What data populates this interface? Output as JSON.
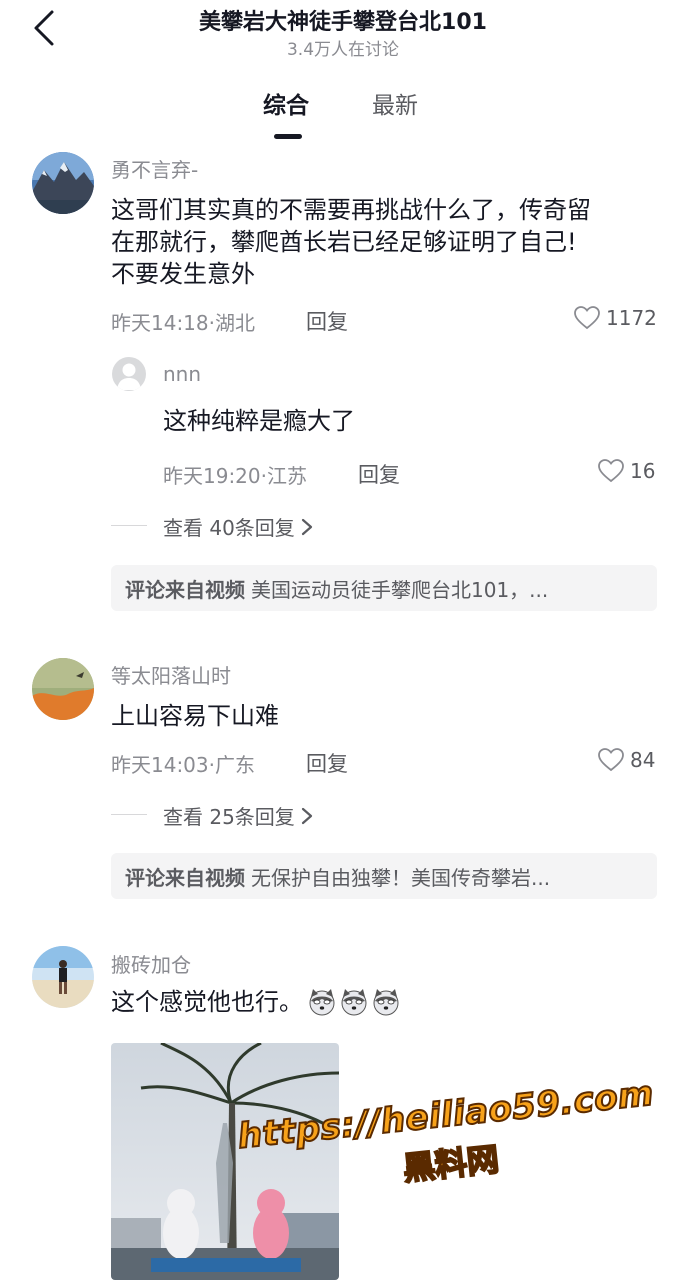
{
  "header": {
    "title": "美攀岩大神徒手攀登台北101",
    "subtitle": "3.4万人在讨论",
    "back_icon": "chevron-left-icon"
  },
  "tabs": [
    {
      "label": "综合",
      "active": true
    },
    {
      "label": "最新",
      "active": false
    }
  ],
  "comments": [
    {
      "username": "勇不言弃-",
      "content_lines": [
        "这哥们其实真的不需要再挑战什么了，传奇留",
        "在那就行，攀爬酋长岩已经足够证明了自己!",
        "不要发生意外"
      ],
      "time_location": "昨天14:18·湖北",
      "reply_label": "回复",
      "likes": "1172",
      "sub_reply": {
        "username": "nnn",
        "content": "这种纯粹是瘾大了",
        "time_location": "昨天19:20·江苏",
        "reply_label": "回复",
        "likes": "16"
      },
      "more_replies": "查看 40条回复",
      "source_label": "评论来自视频",
      "source_text": "美国运动员徒手攀爬台北101，..."
    },
    {
      "username": "等太阳落山时",
      "content_lines": [
        "上山容易下山难"
      ],
      "time_location": "昨天14:03·广东",
      "reply_label": "回复",
      "likes": "84",
      "more_replies": "查看 25条回复",
      "source_label": "评论来自视频",
      "source_text": "无保护自由独攀！美国传奇攀岩..."
    },
    {
      "username": "搬砖加仓",
      "content": "这个感觉他也行。",
      "emoji": [
        "husky-emoji",
        "husky-emoji",
        "husky-emoji"
      ]
    }
  ],
  "watermark": {
    "url": "https://heiliao59.com",
    "name": "黑料网"
  },
  "colors": {
    "primary_text": "#161823",
    "secondary_text": "#8a8b91",
    "source_bg": "#f4f4f5",
    "watermark": "#f7a21a"
  }
}
